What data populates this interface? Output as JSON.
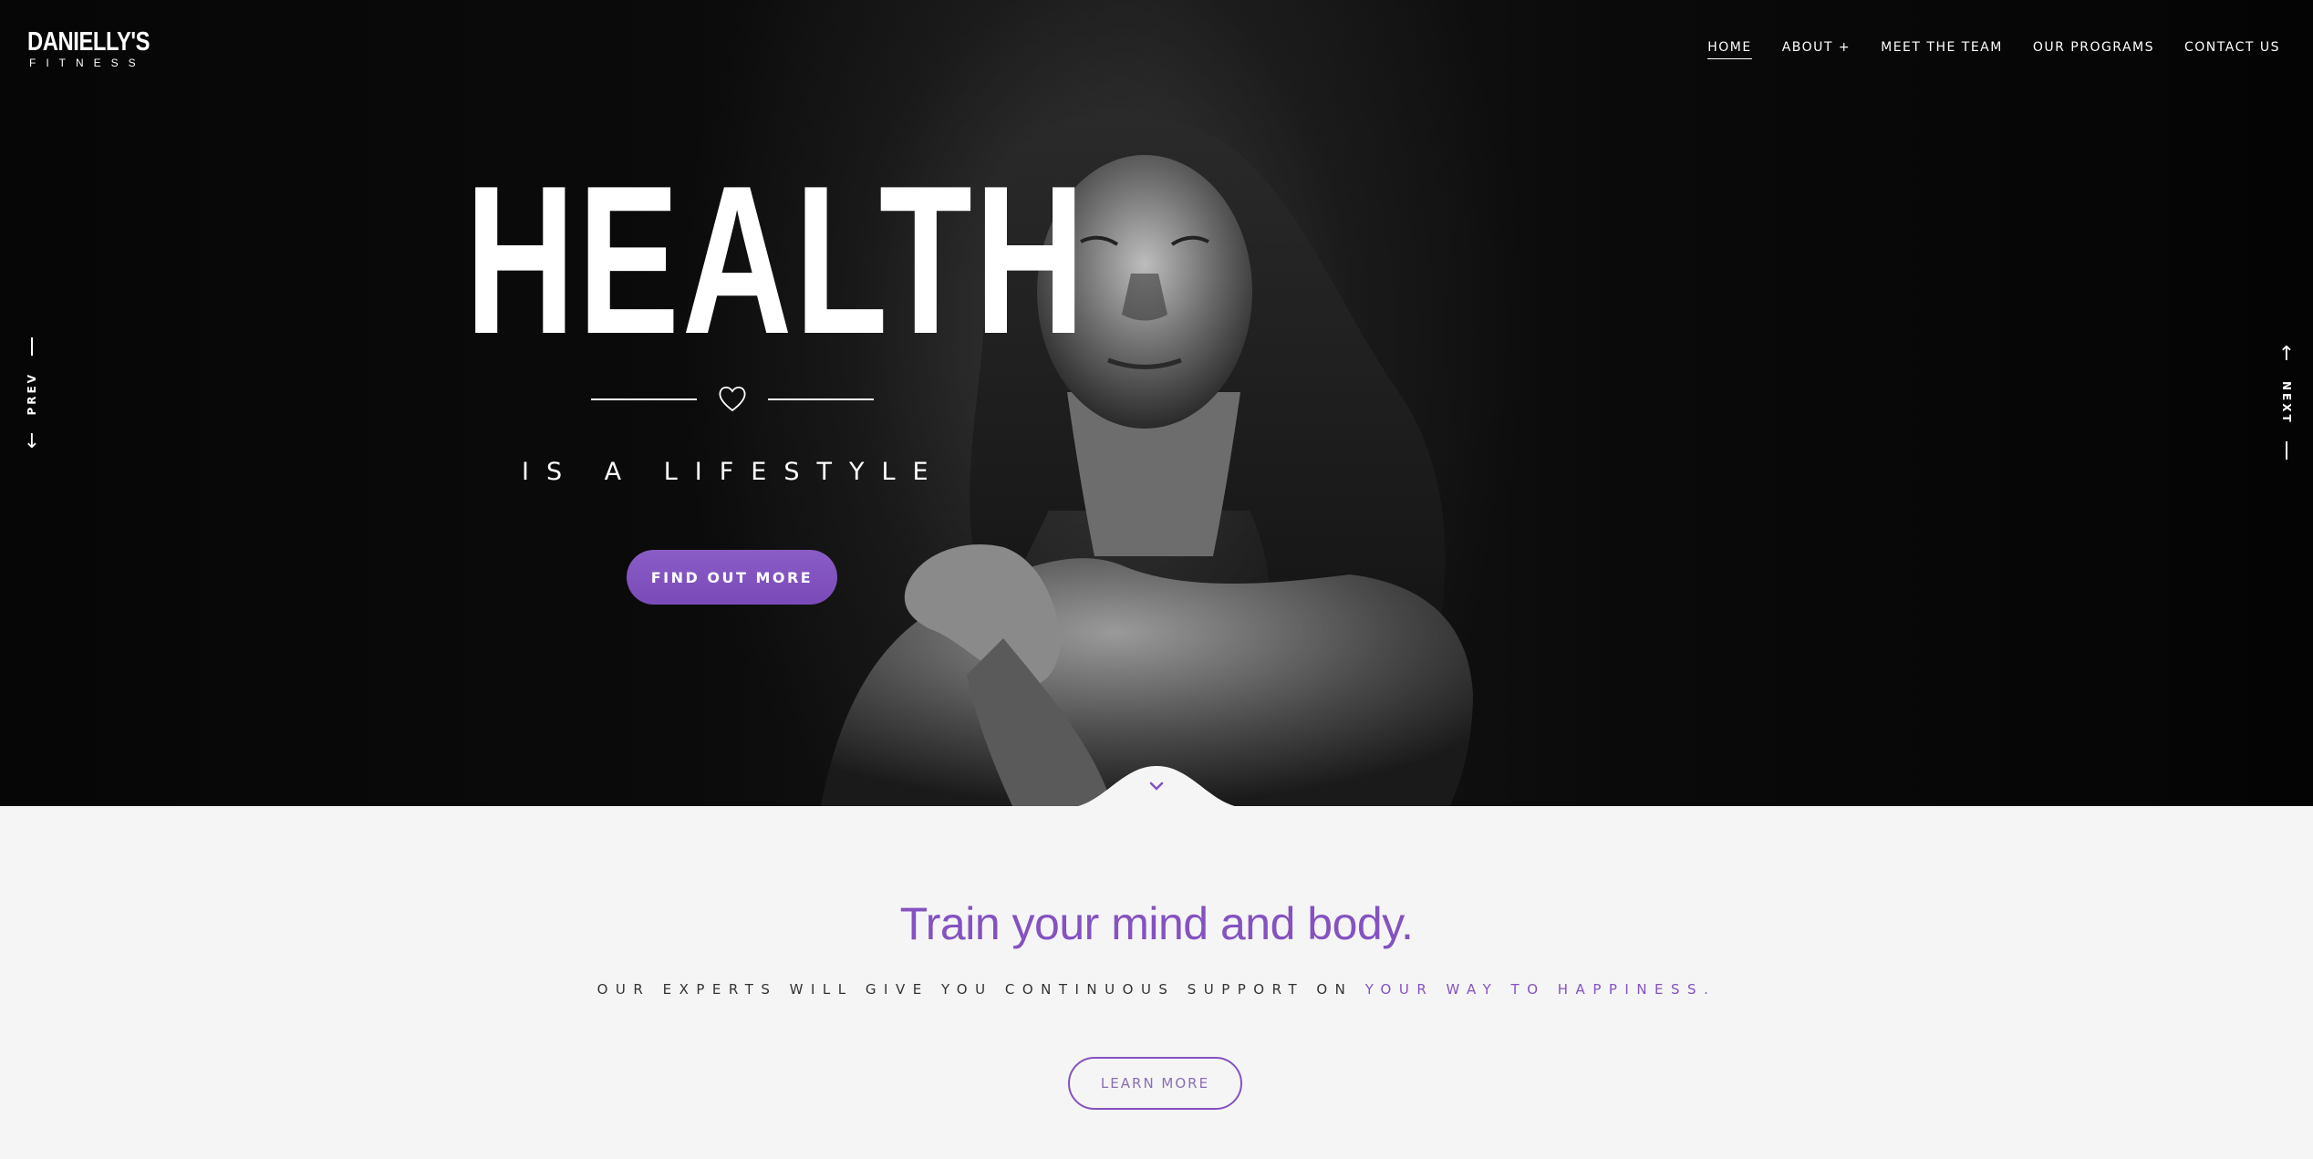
{
  "brand": {
    "name": "DANIELLY'S",
    "subtitle": "FITNESS"
  },
  "nav": {
    "items": [
      {
        "label": "HOME",
        "active": true
      },
      {
        "label": "ABOUT +",
        "active": false
      },
      {
        "label": "MEET THE TEAM",
        "active": false
      },
      {
        "label": "OUR PROGRAMS",
        "active": false
      },
      {
        "label": "CONTACT US",
        "active": false
      }
    ]
  },
  "hero": {
    "headline": "HEALTH",
    "tagline": "IS A LIFESTYLE",
    "cta_label": "FIND OUT MORE",
    "prev_label": "PREV",
    "next_label": "NEXT"
  },
  "intro": {
    "title": "Train your mind and body.",
    "subtitle_prefix": "OUR EXPERTS WILL GIVE YOU CONTINUOUS SUPPORT ON",
    "subtitle_highlight": "YOUR WAY TO HAPPINESS.",
    "button_label": "LEARN MORE"
  },
  "icons": {
    "heart": "heart-icon",
    "scroll": "chevron-down-icon",
    "prev_arrow": "arrow-down-icon",
    "next_arrow": "arrow-up-icon"
  },
  "colors": {
    "accent": "#8552c0",
    "cta_fill": "#7a4bb8",
    "hero_bg": "#0a0a0a",
    "section_bg": "#f5f5f5",
    "text_dark": "#333333"
  }
}
